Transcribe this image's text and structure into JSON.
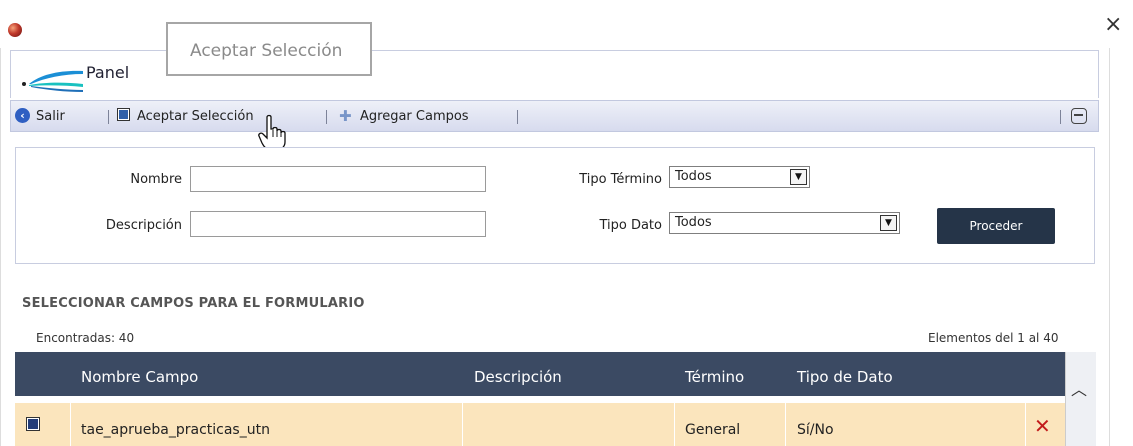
{
  "window": {
    "close_label": "×"
  },
  "tooltip": {
    "text": "Aceptar Selección"
  },
  "panel": {
    "title": "Panel"
  },
  "toolbar": {
    "exit_label": "Salir",
    "accept_label": "Aceptar Selección",
    "add_label": "Agregar Campos"
  },
  "filters": {
    "name_label": "Nombre",
    "name_value": "",
    "description_label": "Descripción",
    "description_value": "",
    "term_type_label": "Tipo Término",
    "term_type_value": "Todos",
    "data_type_label": "Tipo Dato",
    "data_type_value": "Todos",
    "proceed_label": "Proceder"
  },
  "section": {
    "title": "SELECCIONAR CAMPOS PARA EL FORMULARIO",
    "found_text": "Encontradas: 40",
    "range_text": "Elementos del 1 al 40"
  },
  "table": {
    "headers": [
      "Nombre Campo",
      "Descripción",
      "Término",
      "Tipo de Dato"
    ],
    "rows": [
      {
        "name": "tae_aprueba_practicas_utn",
        "description": "",
        "term": "General",
        "data_type": "Sí/No",
        "checked": true
      }
    ]
  },
  "colors": {
    "header_bg": "#3b4a63",
    "row_bg": "#fbe5bd",
    "button_bg": "#253448",
    "delete": "#c21b1b"
  }
}
